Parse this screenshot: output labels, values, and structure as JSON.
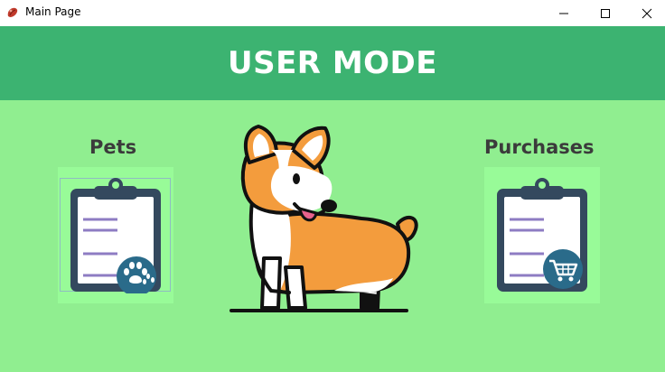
{
  "window": {
    "title": "Main Page",
    "icon": "app-icon",
    "controls": [
      "minimize-icon",
      "maximize-icon",
      "close-icon"
    ]
  },
  "header": {
    "title": "USER MODE"
  },
  "sections": {
    "pets": {
      "label": "Pets",
      "icon": "clipboard-paw-icon"
    },
    "purchases": {
      "label": "Purchases",
      "icon": "clipboard-cart-icon"
    }
  },
  "illustration": {
    "icon": "corgi-illustration"
  },
  "colors": {
    "background": "#90ee90",
    "header": "#3cb371",
    "tile": "#98fb98",
    "clipboard": "#34495e",
    "badge": "#2a6b8a",
    "lines": "#8e7cc3",
    "corgi_orange": "#f39c3d"
  }
}
